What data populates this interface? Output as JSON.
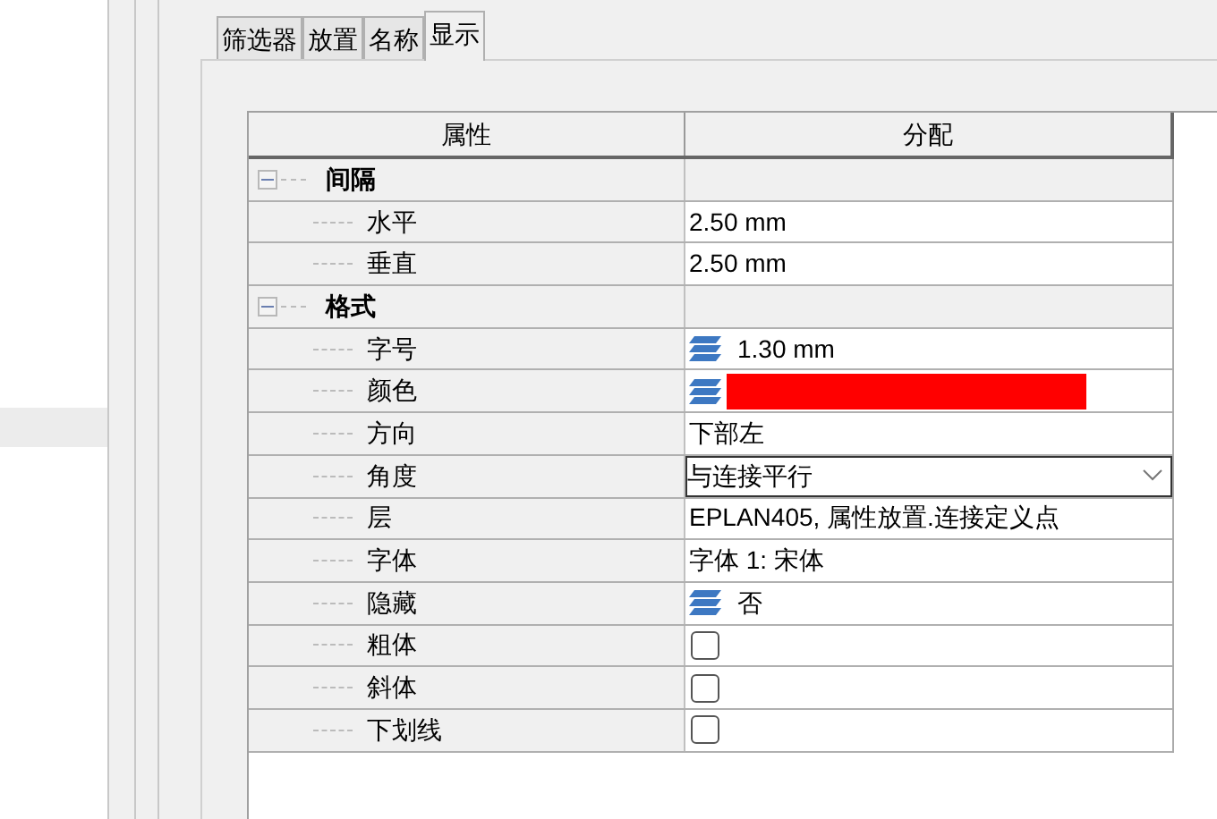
{
  "tabs": [
    {
      "label": "筛选器",
      "selected": false
    },
    {
      "label": "放置",
      "selected": false
    },
    {
      "label": "名称",
      "selected": false
    },
    {
      "label": "显示",
      "selected": true
    }
  ],
  "table": {
    "columns": [
      "属性",
      "分配"
    ],
    "groups": [
      {
        "label": "间隔",
        "expanded": true,
        "children": [
          {
            "label": "水平",
            "kind": "text",
            "value": "2.50 mm"
          },
          {
            "label": "垂直",
            "kind": "text",
            "value": "2.50 mm"
          }
        ]
      },
      {
        "label": "格式",
        "expanded": true,
        "children": [
          {
            "label": "字号",
            "kind": "layered",
            "value": "1.30 mm"
          },
          {
            "label": "颜色",
            "kind": "color",
            "color": "#ff0000"
          },
          {
            "label": "方向",
            "kind": "text",
            "value": "下部左"
          },
          {
            "label": "角度",
            "kind": "dropdown",
            "value": "与连接平行"
          },
          {
            "label": "层",
            "kind": "text",
            "value": "EPLAN405, 属性放置.连接定义点"
          },
          {
            "label": "字体",
            "kind": "text",
            "value": "字体 1: 宋体"
          },
          {
            "label": "隐藏",
            "kind": "layered",
            "value": "否"
          },
          {
            "label": "粗体",
            "kind": "checkbox",
            "checked": false
          },
          {
            "label": "斜体",
            "kind": "checkbox",
            "checked": false
          },
          {
            "label": "下划线",
            "kind": "checkbox",
            "checked": false
          }
        ]
      }
    ]
  }
}
